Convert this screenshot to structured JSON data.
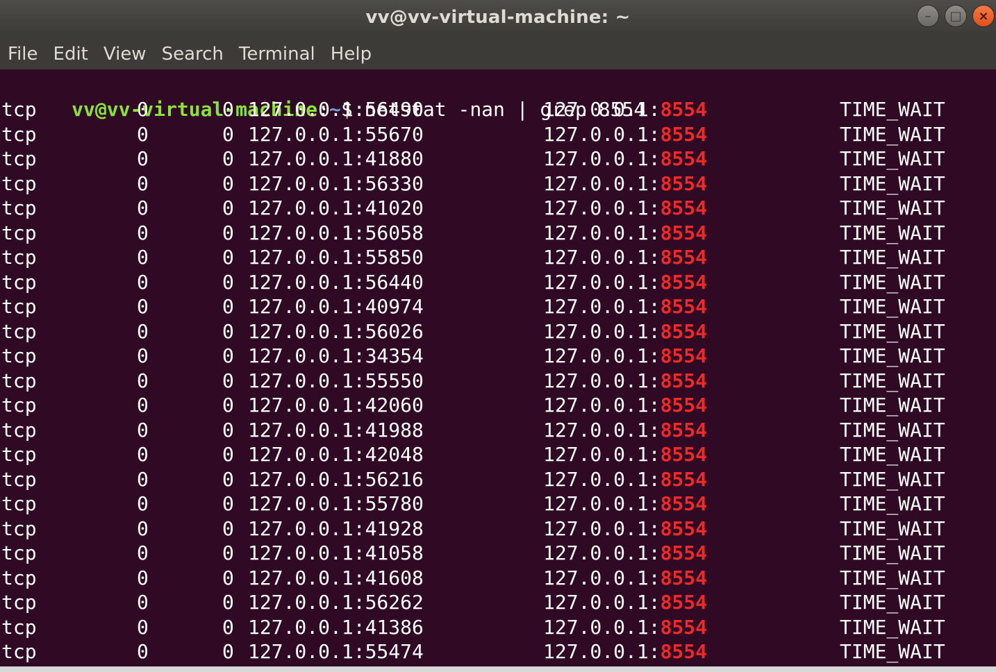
{
  "window": {
    "title": "vv@vv-virtual-machine: ~",
    "buttons": {
      "minimize": "–",
      "maximize": "□",
      "close": "×"
    }
  },
  "menu": [
    "File",
    "Edit",
    "View",
    "Search",
    "Terminal",
    "Help"
  ],
  "prompt": {
    "user_host": "vv@vv-virtual-machine",
    "colon": ":",
    "path": "~",
    "dollar": "$ ",
    "command": "netstat -nan | grep 8554"
  },
  "highlight_port": "8554",
  "colors": {
    "background": "#300a24",
    "prompt_user": "#8ae234",
    "prompt_path": "#729fcf",
    "match": "#ef2929"
  },
  "rows": [
    {
      "proto": "tcp",
      "recv_q": "0",
      "send_q": "0",
      "local": "127.0.0.1:56490",
      "foreign_ip": "127.0.0.1:",
      "foreign_port": "8554",
      "state": "TIME_WAIT"
    },
    {
      "proto": "tcp",
      "recv_q": "0",
      "send_q": "0",
      "local": "127.0.0.1:55670",
      "foreign_ip": "127.0.0.1:",
      "foreign_port": "8554",
      "state": "TIME_WAIT"
    },
    {
      "proto": "tcp",
      "recv_q": "0",
      "send_q": "0",
      "local": "127.0.0.1:41880",
      "foreign_ip": "127.0.0.1:",
      "foreign_port": "8554",
      "state": "TIME_WAIT"
    },
    {
      "proto": "tcp",
      "recv_q": "0",
      "send_q": "0",
      "local": "127.0.0.1:56330",
      "foreign_ip": "127.0.0.1:",
      "foreign_port": "8554",
      "state": "TIME_WAIT"
    },
    {
      "proto": "tcp",
      "recv_q": "0",
      "send_q": "0",
      "local": "127.0.0.1:41020",
      "foreign_ip": "127.0.0.1:",
      "foreign_port": "8554",
      "state": "TIME_WAIT"
    },
    {
      "proto": "tcp",
      "recv_q": "0",
      "send_q": "0",
      "local": "127.0.0.1:56058",
      "foreign_ip": "127.0.0.1:",
      "foreign_port": "8554",
      "state": "TIME_WAIT"
    },
    {
      "proto": "tcp",
      "recv_q": "0",
      "send_q": "0",
      "local": "127.0.0.1:55850",
      "foreign_ip": "127.0.0.1:",
      "foreign_port": "8554",
      "state": "TIME_WAIT"
    },
    {
      "proto": "tcp",
      "recv_q": "0",
      "send_q": "0",
      "local": "127.0.0.1:56440",
      "foreign_ip": "127.0.0.1:",
      "foreign_port": "8554",
      "state": "TIME_WAIT"
    },
    {
      "proto": "tcp",
      "recv_q": "0",
      "send_q": "0",
      "local": "127.0.0.1:40974",
      "foreign_ip": "127.0.0.1:",
      "foreign_port": "8554",
      "state": "TIME_WAIT"
    },
    {
      "proto": "tcp",
      "recv_q": "0",
      "send_q": "0",
      "local": "127.0.0.1:56026",
      "foreign_ip": "127.0.0.1:",
      "foreign_port": "8554",
      "state": "TIME_WAIT"
    },
    {
      "proto": "tcp",
      "recv_q": "0",
      "send_q": "0",
      "local": "127.0.0.1:34354",
      "foreign_ip": "127.0.0.1:",
      "foreign_port": "8554",
      "state": "TIME_WAIT"
    },
    {
      "proto": "tcp",
      "recv_q": "0",
      "send_q": "0",
      "local": "127.0.0.1:55550",
      "foreign_ip": "127.0.0.1:",
      "foreign_port": "8554",
      "state": "TIME_WAIT"
    },
    {
      "proto": "tcp",
      "recv_q": "0",
      "send_q": "0",
      "local": "127.0.0.1:42060",
      "foreign_ip": "127.0.0.1:",
      "foreign_port": "8554",
      "state": "TIME_WAIT"
    },
    {
      "proto": "tcp",
      "recv_q": "0",
      "send_q": "0",
      "local": "127.0.0.1:41988",
      "foreign_ip": "127.0.0.1:",
      "foreign_port": "8554",
      "state": "TIME_WAIT"
    },
    {
      "proto": "tcp",
      "recv_q": "0",
      "send_q": "0",
      "local": "127.0.0.1:42048",
      "foreign_ip": "127.0.0.1:",
      "foreign_port": "8554",
      "state": "TIME_WAIT"
    },
    {
      "proto": "tcp",
      "recv_q": "0",
      "send_q": "0",
      "local": "127.0.0.1:56216",
      "foreign_ip": "127.0.0.1:",
      "foreign_port": "8554",
      "state": "TIME_WAIT"
    },
    {
      "proto": "tcp",
      "recv_q": "0",
      "send_q": "0",
      "local": "127.0.0.1:55780",
      "foreign_ip": "127.0.0.1:",
      "foreign_port": "8554",
      "state": "TIME_WAIT"
    },
    {
      "proto": "tcp",
      "recv_q": "0",
      "send_q": "0",
      "local": "127.0.0.1:41928",
      "foreign_ip": "127.0.0.1:",
      "foreign_port": "8554",
      "state": "TIME_WAIT"
    },
    {
      "proto": "tcp",
      "recv_q": "0",
      "send_q": "0",
      "local": "127.0.0.1:41058",
      "foreign_ip": "127.0.0.1:",
      "foreign_port": "8554",
      "state": "TIME_WAIT"
    },
    {
      "proto": "tcp",
      "recv_q": "0",
      "send_q": "0",
      "local": "127.0.0.1:41608",
      "foreign_ip": "127.0.0.1:",
      "foreign_port": "8554",
      "state": "TIME_WAIT"
    },
    {
      "proto": "tcp",
      "recv_q": "0",
      "send_q": "0",
      "local": "127.0.0.1:56262",
      "foreign_ip": "127.0.0.1:",
      "foreign_port": "8554",
      "state": "TIME_WAIT"
    },
    {
      "proto": "tcp",
      "recv_q": "0",
      "send_q": "0",
      "local": "127.0.0.1:41386",
      "foreign_ip": "127.0.0.1:",
      "foreign_port": "8554",
      "state": "TIME_WAIT"
    },
    {
      "proto": "tcp",
      "recv_q": "0",
      "send_q": "0",
      "local": "127.0.0.1:55474",
      "foreign_ip": "127.0.0.1:",
      "foreign_port": "8554",
      "state": "TIME_WAIT"
    }
  ]
}
